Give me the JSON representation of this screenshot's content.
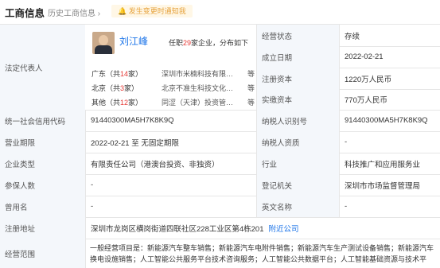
{
  "tabs": {
    "primary": "工商信息",
    "secondary": "历史工商信息 ›",
    "alert": "发生变更时通知我"
  },
  "rep": {
    "label": "法定代表人",
    "name": "刘江峰",
    "held_pre": "任职",
    "held_num": "29",
    "held_post": "家企业，分布如下",
    "rows": [
      {
        "region": "广东",
        "count": "14",
        "corp": "广东（共14家）深圳市米楠科技有限…",
        "etc": "等"
      },
      {
        "region": "北京",
        "count": "3",
        "corp": "北京不准生科技文化…",
        "etc": "等"
      },
      {
        "region": "其他",
        "count": "12",
        "corp": "同涩（天津）投资管…",
        "etc": "等"
      }
    ]
  },
  "fields": {
    "status_label": "经营状态",
    "status": "存续",
    "est_label": "成立日期",
    "est": "2022-02-21",
    "reg_cap_label": "注册资本",
    "reg_cap": "1220万人民币",
    "paid_cap_label": "实缴资本",
    "paid_cap": "770万人民币",
    "credit_label": "统一社会信用代码",
    "credit": "91440300MA5H7K8K9Q",
    "tax_label": "纳税人识别号",
    "tax": "91440300MA5H7K8K9Q",
    "term_label": "营业期限",
    "term": "2022-02-21 至 无固定期限",
    "taxpayer_label": "纳税人资质",
    "taxpayer": "-",
    "type_label": "企业类型",
    "type": "有限责任公司（港澳台投资、非独资）",
    "industry_label": "行业",
    "industry": "科技推广和应用服务业",
    "insured_label": "参保人数",
    "insured": "-",
    "authority_label": "登记机关",
    "authority": "深圳市市场监督管理局",
    "former_label": "曾用名",
    "former": "-",
    "english_label": "英文名称",
    "english": "-",
    "addr_label": "注册地址",
    "addr": "深圳市龙岗区横岗街道四联社区228工业区第4栋201",
    "addr_link": "附近公司",
    "scope_label": "经营范围",
    "scope": "一般经营项目是：新能源汽车整车销售；新能源汽车电附件销售；新能源汽车生产测试设备销售；新能源汽车换电设施销售；人工智能公共服务平台技术咨询服务；人工智能公共数据平台；人工智能基础资源与技术平台；人工智能"
  }
}
